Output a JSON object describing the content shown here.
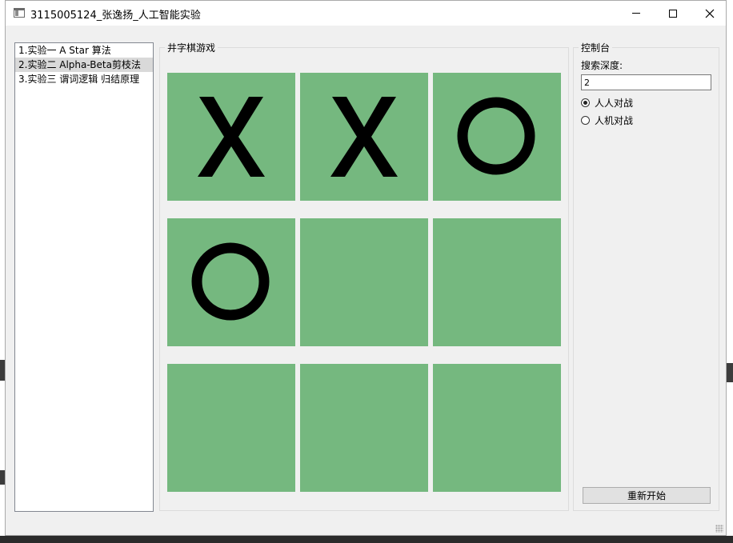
{
  "window": {
    "title": "3115005124_张逸扬_人工智能实验"
  },
  "experiments": {
    "items": [
      {
        "label": "1.实验一  A Star 算法",
        "selected": false
      },
      {
        "label": "2.实验二  Alpha-Beta剪枝法",
        "selected": true
      },
      {
        "label": "3.实验三  谓词逻辑 归结原理",
        "selected": false
      }
    ]
  },
  "game": {
    "title": "井字棋游戏",
    "board": [
      [
        "X",
        "X",
        "O"
      ],
      [
        "O",
        "",
        ""
      ],
      [
        "",
        "",
        ""
      ]
    ],
    "cell_color": "#75b87f",
    "mark_color": "#000000"
  },
  "console": {
    "title": "控制台",
    "depth_label": "搜索深度:",
    "depth_value": "2",
    "modes": [
      {
        "label": "人人对战",
        "checked": true
      },
      {
        "label": "人机对战",
        "checked": false
      }
    ],
    "restart_label": "重新开始"
  }
}
